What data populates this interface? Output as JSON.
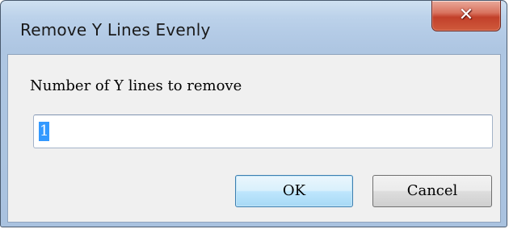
{
  "window": {
    "title": "Remove Y Lines Evenly"
  },
  "prompt": {
    "label": "Number of Y lines to remove"
  },
  "input": {
    "value": "1"
  },
  "buttons": {
    "ok_label": "OK",
    "cancel_label": "Cancel"
  },
  "icons": {
    "close": "close-icon"
  },
  "colors": {
    "selection": "#3399ff",
    "close_button": "#c2402a",
    "ok_button_border": "#3c7fb1"
  }
}
